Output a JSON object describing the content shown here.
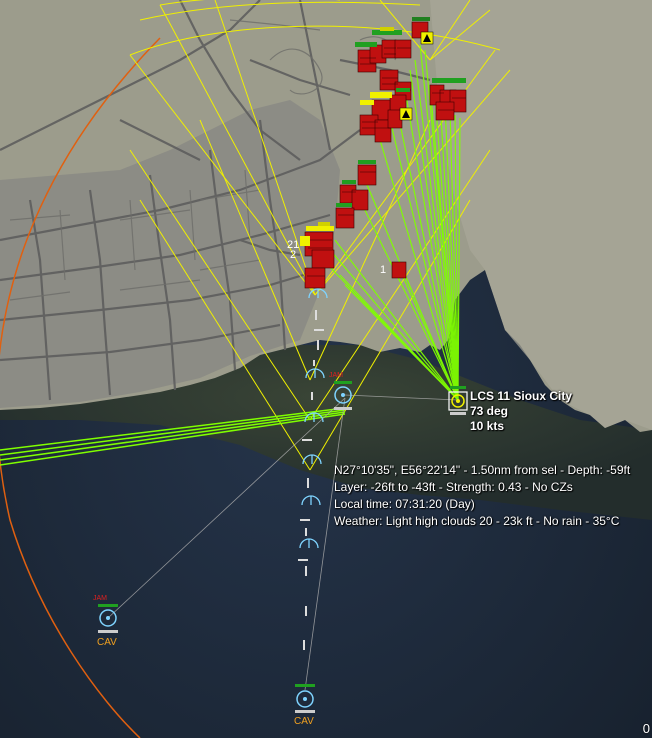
{
  "map": {
    "selected_unit": {
      "name": "LCS 11 Sioux City",
      "heading": "73 deg",
      "speed": "10 kts"
    },
    "hover_info": {
      "line1": "N27°10'35\", E56°22'14\" - 1.50nm from sel - Depth: -59ft",
      "line2": "Layer: -26ft to -43ft - Strength: 0.43 - No CZs",
      "line3": "Local time: 07:31:20 (Day)",
      "line4": "Weather: Light high clouds 20 - 23k ft - No rain - 35°C"
    },
    "contact_labels": {
      "jam": "JAM",
      "cav": "CAV",
      "num_1": "1",
      "num_2": "2",
      "num_21": "21"
    },
    "corner_readout": "0",
    "colors": {
      "land": "#9c9c8c",
      "city": "#8a8a84",
      "road": "#5e5e5e",
      "sea": "#1c2a3a",
      "shallow": "#2c3a2e",
      "arc_yellow": "#f0f000",
      "track_green": "#80ff00",
      "hostile_red": "#c01010",
      "range_orange": "#e06010",
      "friendly_cyan": "#7fd4ff",
      "cav_orange": "#f0a020"
    },
    "icons": [
      "hostile-building-icon",
      "friendly-sonobuoy-icon",
      "ship-icon",
      "aircraft-icon"
    ]
  }
}
